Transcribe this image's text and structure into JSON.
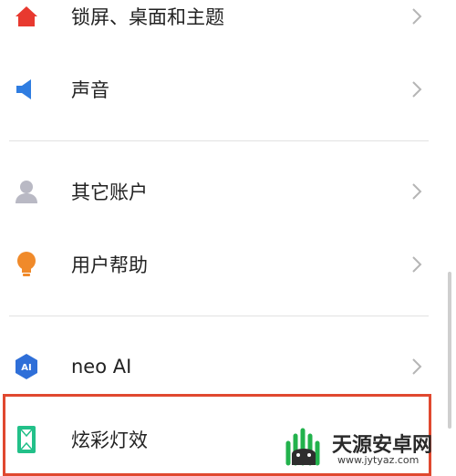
{
  "settings_list": {
    "items": [
      {
        "label": "锁屏、桌面和主题",
        "icon": "home-icon",
        "color": "#e8392f"
      },
      {
        "label": "声音",
        "icon": "speaker-icon",
        "color": "#2f7de1"
      },
      {
        "label": "其它账户",
        "icon": "account-icon",
        "color": "#b9b9c4"
      },
      {
        "label": "用户帮助",
        "icon": "lightbulb-icon",
        "color": "#f08a2a"
      },
      {
        "label": "neo AI",
        "icon": "ai-hexagon-icon",
        "icon_text": "AI",
        "color": "#2f6fd8"
      },
      {
        "label": "炫彩灯效",
        "icon": "light-effect-icon",
        "color": "#22c089"
      }
    ]
  },
  "highlight": {
    "color": "#e0482f"
  },
  "watermark": {
    "brand": "天源安卓网",
    "url": "www.jytyaz.com",
    "color": "#22b24c"
  }
}
